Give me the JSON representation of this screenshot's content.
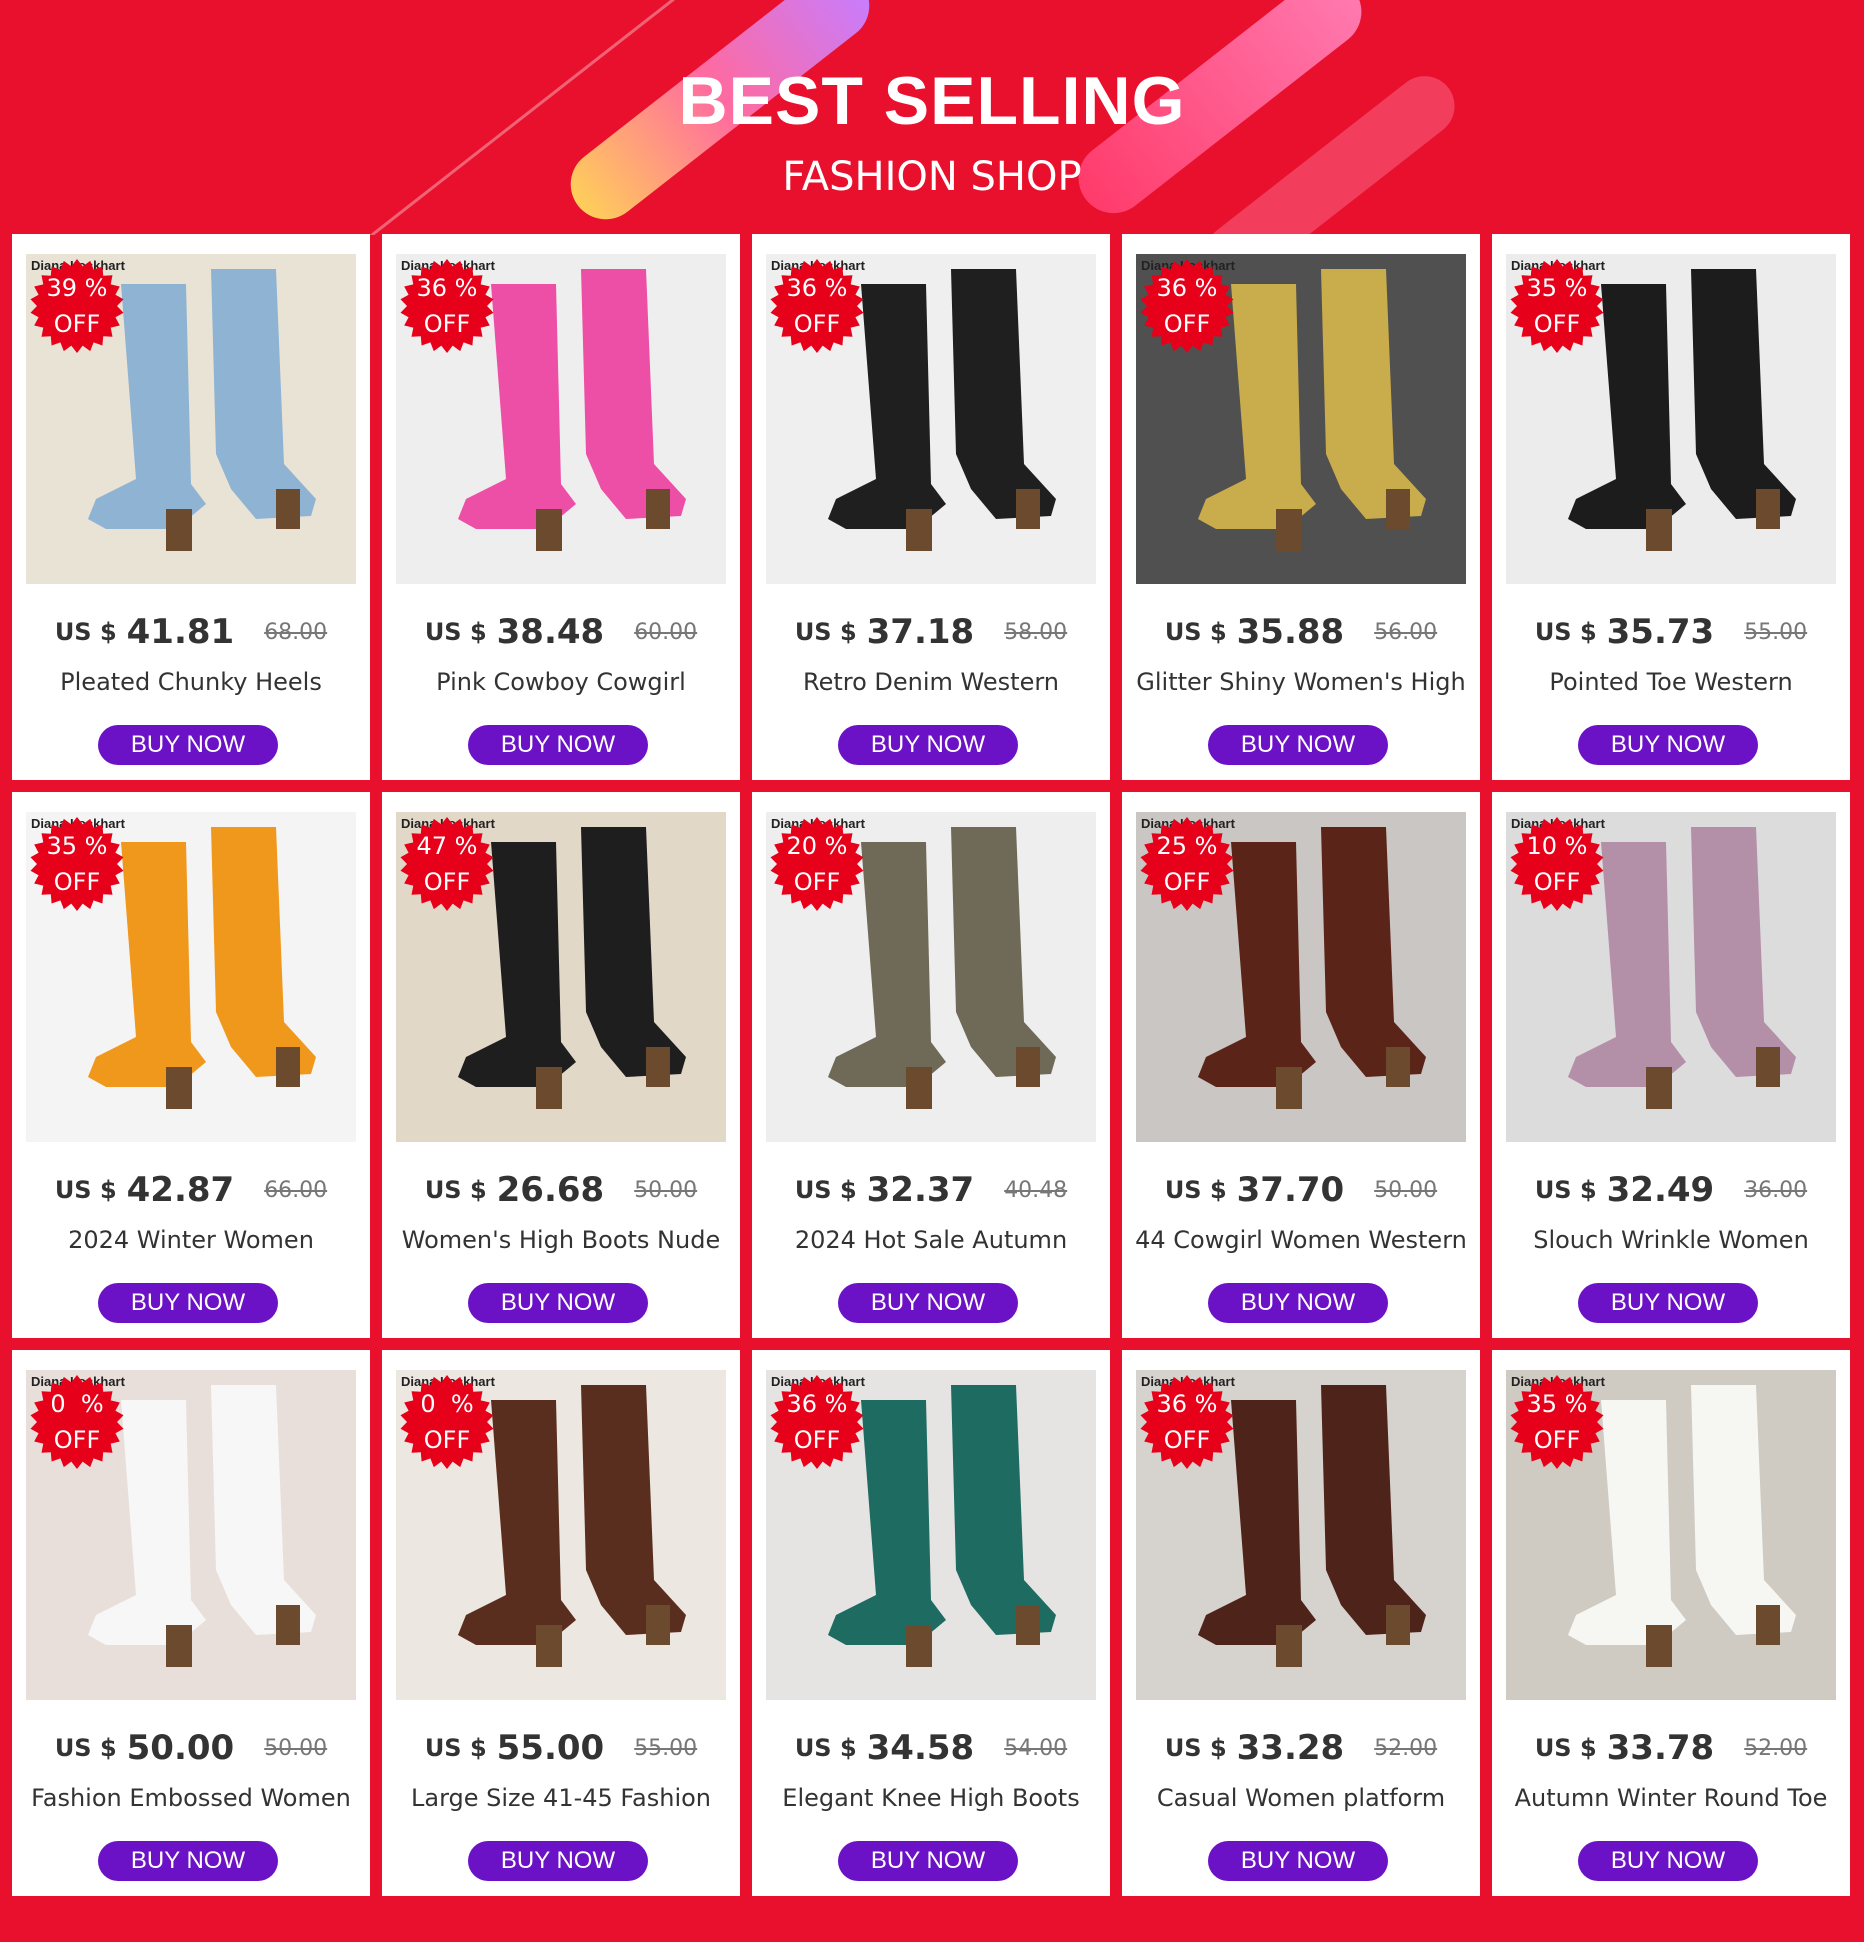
{
  "banner": {
    "title": "BEST SELLING",
    "subtitle": "FASHION SHOP"
  },
  "currency_label": "US $",
  "buy_label": "BUY NOW",
  "off_label": "OFF",
  "brand": "Diana Lockhart",
  "products": [
    {
      "discount": "39 %",
      "price": "41.81",
      "old_price": "68.00",
      "name": "Pleated Chunky Heels",
      "boot_color": "#8fb3d2",
      "bg": "#e9e3d6"
    },
    {
      "discount": "36 %",
      "price": "38.48",
      "old_price": "60.00",
      "name": "Pink Cowboy Cowgirl",
      "boot_color": "#ee4fa6",
      "bg": "#eeeeee"
    },
    {
      "discount": "36 %",
      "price": "37.18",
      "old_price": "58.00",
      "name": "Retro Denim Western",
      "boot_color": "#1f1f1f",
      "bg": "#efefef"
    },
    {
      "discount": "36 %",
      "price": "35.88",
      "old_price": "56.00",
      "name": "Glitter Shiny Women's High",
      "boot_color": "#c9ac4c",
      "bg": "#505050"
    },
    {
      "discount": "35 %",
      "price": "35.73",
      "old_price": "55.00",
      "name": "Pointed Toe Western",
      "boot_color": "#1c1c1c",
      "bg": "#ececec"
    },
    {
      "discount": "35 %",
      "price": "42.87",
      "old_price": "66.00",
      "name": "2024 Winter Women",
      "boot_color": "#f0981c",
      "bg": "#f4f4f4"
    },
    {
      "discount": "47 %",
      "price": "26.68",
      "old_price": "50.00",
      "name": "Women's High Boots Nude",
      "boot_color": "#1e1e1e",
      "bg": "#e2d8c8"
    },
    {
      "discount": "20 %",
      "price": "32.37",
      "old_price": "40.48",
      "name": "2024 Hot Sale Autumn",
      "boot_color": "#6f6a58",
      "bg": "#eeeeee"
    },
    {
      "discount": "25 %",
      "price": "37.70",
      "old_price": "50.00",
      "name": "44 Cowgirl Women Western",
      "boot_color": "#5b2419",
      "bg": "#c9c6c4"
    },
    {
      "discount": "10 %",
      "price": "32.49",
      "old_price": "36.00",
      "name": "Slouch Wrinkle Women",
      "boot_color": "#b48fa8",
      "bg": "#dcdcdc"
    },
    {
      "discount": "0  %",
      "price": "50.00",
      "old_price": "50.00",
      "name": "Fashion Embossed Women",
      "boot_color": "#f7f7f7",
      "bg": "#e8dfda"
    },
    {
      "discount": "0  %",
      "price": "55.00",
      "old_price": "55.00",
      "name": "Large Size 41-45 Fashion",
      "boot_color": "#5a2e1e",
      "bg": "#ece7e0"
    },
    {
      "discount": "36 %",
      "price": "34.58",
      "old_price": "54.00",
      "name": "Elegant Knee High Boots",
      "boot_color": "#1e6b62",
      "bg": "#e6e4e2"
    },
    {
      "discount": "36 %",
      "price": "33.28",
      "old_price": "52.00",
      "name": "Casual Women platform",
      "boot_color": "#4e231a",
      "bg": "#d6d2cd"
    },
    {
      "discount": "35 %",
      "price": "33.78",
      "old_price": "52.00",
      "name": "Autumn Winter Round Toe",
      "boot_color": "#f6f6f3",
      "bg": "#cfcac2"
    }
  ]
}
